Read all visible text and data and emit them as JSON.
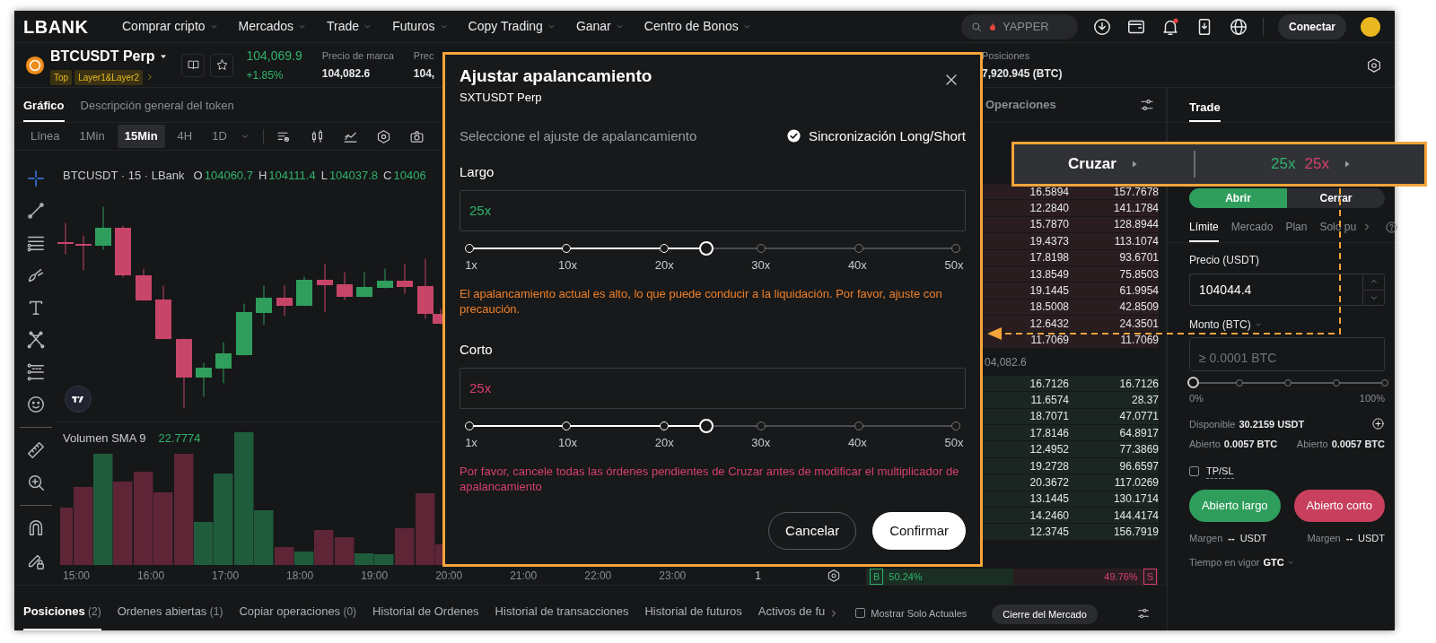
{
  "nav": {
    "logo": "LBANK",
    "menu": [
      {
        "label": "Comprar cripto"
      },
      {
        "label": "Mercados"
      },
      {
        "label": "Trade"
      },
      {
        "label": "Futuros"
      },
      {
        "label": "Copy Trading"
      },
      {
        "label": "Ganar"
      },
      {
        "label": "Centro de Bonos"
      }
    ],
    "search": {
      "placeholder": "YAPPER"
    },
    "connect_button": "Conectar"
  },
  "ticker": {
    "symbol": "BTCUSDT Perp",
    "tags": [
      "Top",
      "Layer1&Layer2"
    ],
    "price": "104,069.9",
    "change": "+1.85%",
    "stats": [
      {
        "label": "Precio de marca",
        "value": "104,082.6"
      },
      {
        "label": "Prec",
        "value": "104,"
      }
    ],
    "positions": {
      "label": "Posiciones",
      "value": "7,920.945 (BTC)"
    }
  },
  "chart_tabs": [
    {
      "label": "Gráfico",
      "selected": true
    },
    {
      "label": "Descripción general del token",
      "selected": false
    }
  ],
  "intervals": [
    {
      "label": "Línea",
      "selected": false
    },
    {
      "label": "1Min",
      "selected": false
    },
    {
      "label": "15Min",
      "selected": true
    },
    {
      "label": "4H",
      "selected": false
    },
    {
      "label": "1D",
      "selected": false
    }
  ],
  "chart": {
    "title": "BTCUSDT · 15 · LBank",
    "ohlc": [
      {
        "key": "O",
        "value": "104060.7"
      },
      {
        "key": "H",
        "value": "104111.4"
      },
      {
        "key": "L",
        "value": "104037.8"
      },
      {
        "key": "C",
        "value": "10406"
      }
    ],
    "volume_label": "Volumen SMA 9",
    "volume_value": "22.7774",
    "time_labels": [
      "15:00",
      "16:00",
      "17:00",
      "18:00",
      "19:00",
      "20:00",
      "21:00",
      "22:00",
      "23:00"
    ],
    "scale_label": "1"
  },
  "order_book": {
    "title": "Operaciones",
    "asks": [
      {
        "amount": "16.5894",
        "total": "157.7678"
      },
      {
        "amount": "12.2840",
        "total": "141.1784"
      },
      {
        "amount": "15.7870",
        "total": "128.8944"
      },
      {
        "amount": "19.4373",
        "total": "113.1074"
      },
      {
        "amount": "17.8198",
        "total": "93.6701"
      },
      {
        "amount": "13.8549",
        "total": "75.8503"
      },
      {
        "amount": "19.1445",
        "total": "61.9954"
      },
      {
        "amount": "18.5008",
        "total": "42.8509"
      },
      {
        "amount": "12.6432",
        "total": "24.3501"
      },
      {
        "amount": "11.7069",
        "total": "11.7069"
      }
    ],
    "mid_price": "04,082.6",
    "bids": [
      {
        "amount": "16.7126",
        "total": "16.7126"
      },
      {
        "amount": "11.6574",
        "total": "28.37"
      },
      {
        "amount": "18.7071",
        "total": "47.0771"
      },
      {
        "amount": "17.8146",
        "total": "64.8917"
      },
      {
        "amount": "12.4952",
        "total": "77.3869"
      },
      {
        "amount": "19.2728",
        "total": "96.6597"
      },
      {
        "amount": "20.3672",
        "total": "117.0269"
      },
      {
        "amount": "13.1445",
        "total": "130.1714"
      },
      {
        "amount": "14.2460",
        "total": "144.4174"
      },
      {
        "amount": "12.3745",
        "total": "156.7919"
      }
    ],
    "buy_ratio": {
      "label": "B",
      "value": "50.24%",
      "level": 0.5024
    },
    "sell_ratio": {
      "label": "S",
      "value": "49.76%"
    }
  },
  "trade_panel": {
    "tab": "Trade",
    "sides": [
      {
        "label": "Abrir",
        "selected": true
      },
      {
        "label": "Cerrar",
        "selected": false
      }
    ],
    "order_types": [
      {
        "label": "Límite",
        "selected": true
      },
      {
        "label": "Mercado",
        "selected": false
      },
      {
        "label": "Plan",
        "selected": false
      },
      {
        "label": "Solo pu",
        "selected": false
      }
    ],
    "price": {
      "label": "Precio (USDT)",
      "value": "104044.4"
    },
    "amount": {
      "label": "Monto (BTC)",
      "placeholder": "≥ 0.0001 BTC"
    },
    "slider": {
      "level": 0,
      "min_label": "0%",
      "max_label": "100%"
    },
    "available": {
      "label": "Disponible",
      "value": "30.2159 USDT"
    },
    "open": [
      {
        "label": "Abierto",
        "value": "0.0057 BTC"
      },
      {
        "label": "Abierto",
        "value": "0.0057 BTC"
      }
    ],
    "tpsl": {
      "label": "TP/SL",
      "checked": false
    },
    "buttons": [
      {
        "label": "Abierto largo",
        "kind": "long"
      },
      {
        "label": "Abierto corto",
        "kind": "short"
      }
    ],
    "margins": [
      {
        "label": "Margen",
        "value": "--",
        "unit": "USDT"
      },
      {
        "label": "Margen",
        "value": "--",
        "unit": "USDT"
      }
    ],
    "time_in_force": {
      "label": "Tiempo en vigor",
      "value": "GTC"
    }
  },
  "bottom_tabs": [
    {
      "label": "Posiciones",
      "count": "(2)",
      "selected": true
    },
    {
      "label": "Ordenes abiertas",
      "count": "(1)",
      "selected": false
    },
    {
      "label": "Copiar operaciones",
      "count": "(0)",
      "selected": false
    },
    {
      "label": "Historial de Ordenes",
      "selected": false
    },
    {
      "label": "Historial de transacciones",
      "selected": false
    },
    {
      "label": "Historial de futuros",
      "selected": false
    },
    {
      "label": "Activos de fu",
      "selected": false
    }
  ],
  "show_current": {
    "label": "Mostrar Solo Actuales",
    "checked": false
  },
  "market_close_button": "Cierre del Mercado",
  "modal": {
    "title": "Ajustar apalancamiento",
    "subtitle": "SXTUSDT Perp",
    "prompt": "Seleccione el ajuste de apalancamiento",
    "sync": {
      "label": "Sincronización Long/Short",
      "checked": true
    },
    "sections": [
      {
        "label": "Largo",
        "value": "25x",
        "kind": "long",
        "level": 0.488,
        "ticks": [
          "1x",
          "10x",
          "20x",
          "30x",
          "40x",
          "50x"
        ],
        "warning": {
          "text": "El apalancamiento actual es alto, lo que puede conducir a la liquidación. Por favor, ajuste con precaución.",
          "color": "#f0802a"
        }
      },
      {
        "label": "Corto",
        "value": "25x",
        "kind": "short",
        "level": 0.488,
        "ticks": [
          "1x",
          "10x",
          "20x",
          "30x",
          "40x",
          "50x"
        ],
        "warning": {
          "text": "Por favor, cancele todas las órdenes pendientes de Cruzar antes de modificar el multiplicador de apalancamiento",
          "color": "#d6406a"
        }
      }
    ],
    "buttons": [
      {
        "label": "Cancelar",
        "kind": "secondary"
      },
      {
        "label": "Confirmar",
        "kind": "primary"
      }
    ]
  },
  "callout": {
    "margin_mode": "Cruzar",
    "long_leverage": "25x",
    "short_leverage": "25x"
  }
}
